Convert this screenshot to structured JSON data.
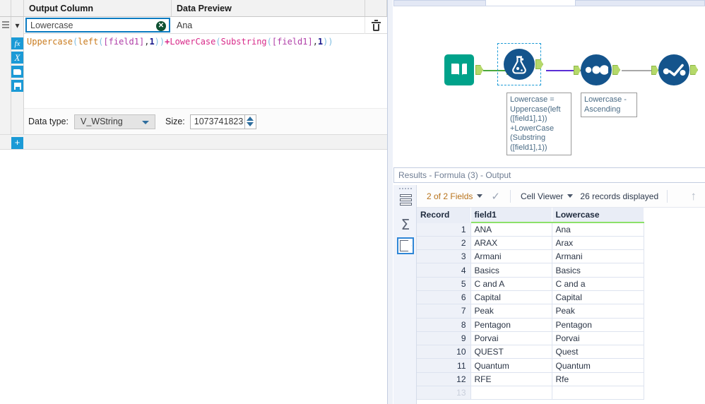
{
  "config_panel": {
    "columns": {
      "output_column": "Output Column",
      "data_preview": "Data Preview"
    },
    "output_name_value": "Lowercase",
    "output_name_placeholder": "Lowercase",
    "data_preview_value": "Ana",
    "clear_icon": "clear-icon",
    "delete_icon": "trash-icon",
    "tool_buttons": [
      {
        "name": "function-button",
        "glyph": "fx"
      },
      {
        "name": "variable-button",
        "glyph": "X"
      },
      {
        "name": "open-button",
        "glyph": "folder"
      },
      {
        "name": "save-button",
        "glyph": "save"
      }
    ],
    "add_button_label": "+",
    "formula_tokens": [
      {
        "t": "Uppercase",
        "c": "tk-fn"
      },
      {
        "t": "(",
        "c": "tk-par"
      },
      {
        "t": "left",
        "c": "tk-fn"
      },
      {
        "t": "(",
        "c": "tk-par"
      },
      {
        "t": "[field1]",
        "c": "tk-fld"
      },
      {
        "t": ",",
        "c": "tk-com"
      },
      {
        "t": "1",
        "c": "tk-num"
      },
      {
        "t": "))",
        "c": "tk-par"
      },
      {
        "t": "+",
        "c": "tk-plus"
      },
      {
        "t": "LowerCase",
        "c": "tk-fn2"
      },
      {
        "t": "(",
        "c": "tk-par"
      },
      {
        "t": "Substring",
        "c": "tk-fn2"
      },
      {
        "t": "(",
        "c": "tk-par"
      },
      {
        "t": "[field1]",
        "c": "tk-fld"
      },
      {
        "t": ",",
        "c": "tk-com"
      },
      {
        "t": "1",
        "c": "tk-num"
      },
      {
        "t": "))",
        "c": "tk-par"
      }
    ],
    "formula_plain": "Uppercase(left([field1],1))+LowerCase(Substring([field1],1))",
    "data_type_label": "Data type:",
    "data_type_value": "V_WString",
    "size_label": "Size:",
    "size_value": "1073741823"
  },
  "canvas": {
    "nodes": [
      {
        "name": "input-data-tool",
        "icon": "book-icon"
      },
      {
        "name": "formula-tool",
        "icon": "flask-icon",
        "selected": true
      },
      {
        "name": "sort-tool",
        "icon": "three-dots-icon"
      },
      {
        "name": "browse-tool",
        "icon": "checkmark-icon"
      }
    ],
    "annotations": [
      {
        "name": "formula-annotation",
        "text": "Lowercase = Uppercase(left([field1],1))\n+LowerCase (Substring ([field1],1))"
      },
      {
        "name": "sort-annotation",
        "text": "Lowercase - Ascending"
      }
    ],
    "annotation_formula_lines": [
      "Lowercase =",
      "Uppercase(left",
      "([field1],1))",
      "+LowerCase",
      "(Substring",
      "([field1],1))"
    ],
    "annotation_sort_lines": [
      "Lowercase -",
      "Ascending"
    ]
  },
  "results": {
    "title_prefix": "Results",
    "title": "Results - Formula (3) - Output",
    "toolbar": {
      "fields_label": "2 of 2 Fields",
      "view_label": "Cell Viewer",
      "records_label": "26 records displayed",
      "check_icon": "checkmark-icon",
      "up_arrow_icon": "arrow-up-icon"
    },
    "rail_buttons": [
      {
        "name": "rows-view-button",
        "icon": "rows-icon"
      },
      {
        "name": "profile-view-button",
        "icon": "sigma-icon"
      },
      {
        "name": "metadata-view-button",
        "icon": "hexagon-icon",
        "active": true
      }
    ],
    "table": {
      "headers": [
        "Record",
        "field1",
        "Lowercase"
      ],
      "rows": [
        [
          "1",
          "ANA",
          "Ana"
        ],
        [
          "2",
          "ARAX",
          "Arax"
        ],
        [
          "3",
          "Armani",
          "Armani"
        ],
        [
          "4",
          "Basics",
          "Basics"
        ],
        [
          "5",
          "C and A",
          "C and a"
        ],
        [
          "6",
          "Capital",
          "Capital"
        ],
        [
          "7",
          "Peak",
          "Peak"
        ],
        [
          "8",
          "Pentagon",
          "Pentagon"
        ],
        [
          "9",
          "Porvai",
          "Porvai"
        ],
        [
          "10",
          "QUEST",
          "Quest"
        ],
        [
          "11",
          "Quantum",
          "Quantum"
        ],
        [
          "12",
          "RFE",
          "Rfe"
        ],
        [
          "13",
          "",
          ""
        ]
      ]
    }
  },
  "colors": {
    "accent_blue": "#1b9ad6",
    "node_blue": "#14548c",
    "input_green": "#00a28a",
    "port_green": "#b5d96a",
    "header_green_underline": "#8ce06a",
    "connection_purple": "#5b2fd6"
  }
}
